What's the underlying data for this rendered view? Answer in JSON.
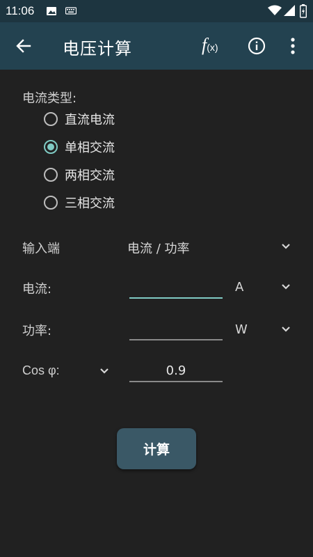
{
  "status_bar": {
    "time": "11:06",
    "icons": [
      "image-icon",
      "keyboard-icon",
      "wifi-icon",
      "signal-icon",
      "battery-charging-icon"
    ]
  },
  "app_bar": {
    "title": "电压计算",
    "formula_main": "f",
    "formula_sub": "(x)",
    "icons": [
      "back-arrow-icon",
      "formula-icon",
      "info-icon",
      "more-vert-icon"
    ]
  },
  "current_type": {
    "label": "电流类型:",
    "options": [
      "直流电流",
      "单相交流",
      "两相交流",
      "三相交流"
    ],
    "selected": "单相交流"
  },
  "input_mode": {
    "label": "输入端",
    "value": "电流 / 功率"
  },
  "current_field": {
    "label": "电流:",
    "value": "",
    "unit": "A"
  },
  "power_field": {
    "label": "功率:",
    "value": "",
    "unit": "W"
  },
  "cos_field": {
    "label": "Cos φ:",
    "value": "0.9"
  },
  "calculate_button": "计算",
  "colors": {
    "background": "#212121",
    "app_bar": "#234250",
    "status_bar": "#1d3540",
    "accent": "#80cbc4",
    "button": "#3a5866"
  }
}
